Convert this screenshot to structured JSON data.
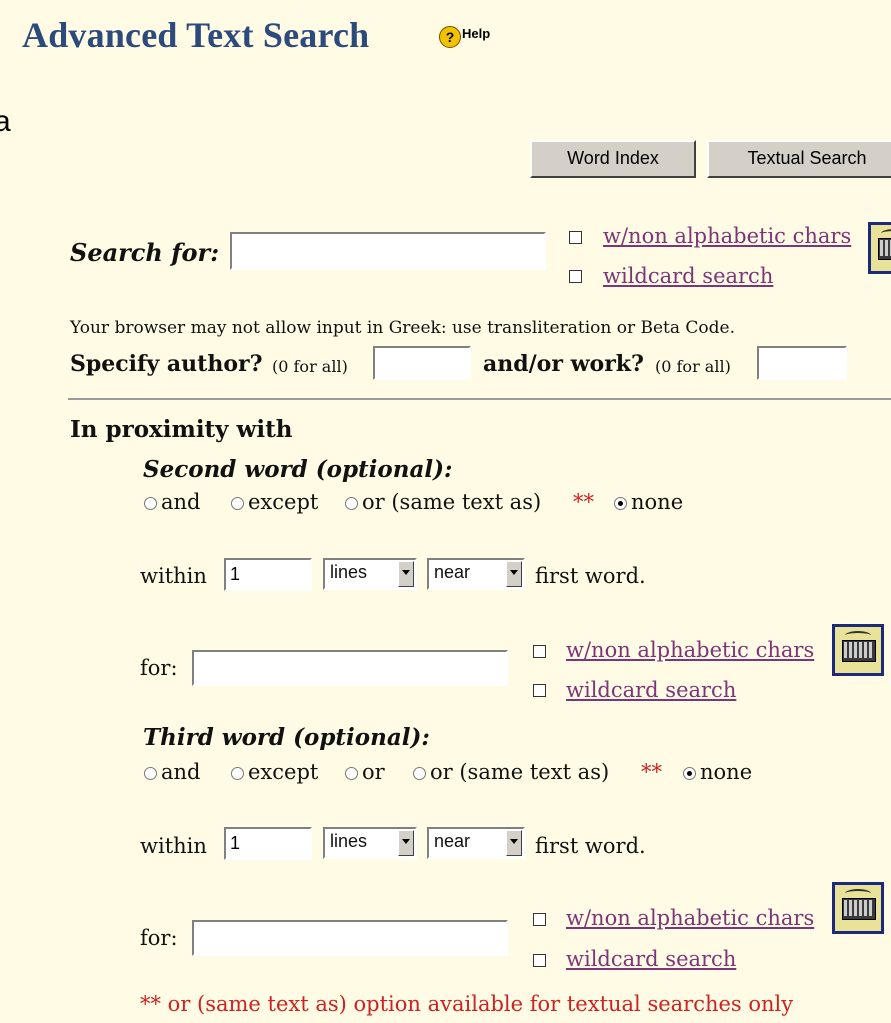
{
  "header": {
    "title": "Advanced Text Search",
    "help_label": "Help",
    "help_icon": "?"
  },
  "stray_char": "a",
  "toolbar": {
    "word_index": "Word Index",
    "textual_search": "Textual Search"
  },
  "search": {
    "label": "Search for:",
    "value": "",
    "nonalpha_label": "w/non alphabetic chars",
    "wildcard_label": "wildcard search",
    "nonalpha_checked": false,
    "wildcard_checked": false
  },
  "browser_note": "Your browser may not allow input in Greek: use transliteration or Beta Code.",
  "author": {
    "label": "Specify author?",
    "hint": "(0 for all)",
    "value": "",
    "work_label": "and/or work?",
    "work_hint": "(0 for all)",
    "work_value": ""
  },
  "proximity": {
    "heading": "In proximity with",
    "second": {
      "heading": "Second word (optional):",
      "options": [
        "and",
        "except",
        "or (same text as)",
        "none"
      ],
      "selected": "none",
      "asterisks": "**",
      "within_label": "within",
      "within_value": "1",
      "unit": "lines",
      "relation": "near",
      "first_word": "first word.",
      "for_label": "for:",
      "for_value": "",
      "nonalpha_label": "w/non alphabetic chars",
      "wildcard_label": "wildcard search"
    },
    "third": {
      "heading": "Third word (optional):",
      "options": [
        "and",
        "except",
        "or",
        "or (same text as)",
        "none"
      ],
      "selected": "none",
      "asterisks": "**",
      "within_label": "within",
      "within_value": "1",
      "unit": "lines",
      "relation": "near",
      "first_word": "first word.",
      "for_label": "for:",
      "for_value": "",
      "nonalpha_label": "w/non alphabetic chars",
      "wildcard_label": "wildcard search"
    }
  },
  "footnote": "** or (same text as) option available for textual searches only",
  "colors": {
    "title": "#2c4a7c",
    "link": "#7c3577",
    "note": "#cc2222",
    "background": "#fffbe4",
    "keyboard_border": "#1c2a78"
  }
}
